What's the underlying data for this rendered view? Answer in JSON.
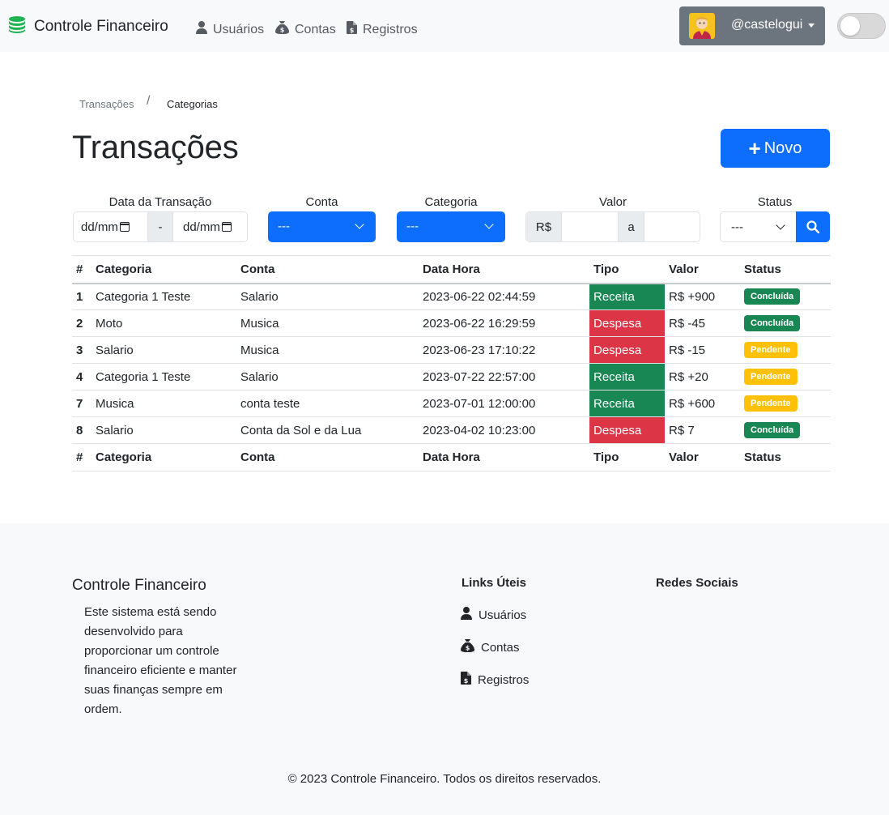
{
  "navbar": {
    "brand": "Controle Financeiro",
    "links": [
      {
        "label": "Usuários",
        "icon": "user-icon"
      },
      {
        "label": "Contas",
        "icon": "money-bag-icon"
      },
      {
        "label": "Registros",
        "icon": "invoice-icon"
      }
    ],
    "user": "@castelogui",
    "theme_toggle": "off"
  },
  "breadcrumb": [
    "Transações",
    "Categorias"
  ],
  "page": {
    "title": "Transações",
    "new_button": "Novo"
  },
  "filters": {
    "date_label": "Data da Transação",
    "date_from_placeholder": "dd/mm",
    "date_separator": "-",
    "date_to_placeholder": "dd/mm",
    "conta_label": "Conta",
    "conta_value": "---",
    "categoria_label": "Categoria",
    "categoria_value": "---",
    "valor_label": "Valor",
    "valor_prefix": "R$",
    "valor_separator": "a",
    "status_label": "Status",
    "status_value": "---"
  },
  "table": {
    "headers": [
      "#",
      "Categoria",
      "Conta",
      "Data Hora",
      "Tipo",
      "Valor",
      "Status"
    ],
    "rows": [
      {
        "id": "1",
        "categoria": "Categoria 1 Teste",
        "conta": "Salario",
        "data": "2023-06-22 02:44:59",
        "tipo": "Receita",
        "valor": "R$ +900",
        "status": "Concluída"
      },
      {
        "id": "2",
        "categoria": "Moto",
        "conta": "Musica",
        "data": "2023-06-22 16:29:59",
        "tipo": "Despesa",
        "valor": "R$ -45",
        "status": "Concluída"
      },
      {
        "id": "3",
        "categoria": "Salario",
        "conta": "Musica",
        "data": "2023-06-23 17:10:22",
        "tipo": "Despesa",
        "valor": "R$ -15",
        "status": "Pendente"
      },
      {
        "id": "4",
        "categoria": "Categoria 1 Teste",
        "conta": "Salario",
        "data": "2023-07-22 22:57:00",
        "tipo": "Receita",
        "valor": "R$ +20",
        "status": "Pendente"
      },
      {
        "id": "7",
        "categoria": "Musica",
        "conta": "conta teste",
        "data": "2023-07-01 12:00:00",
        "tipo": "Receita",
        "valor": "R$ +600",
        "status": "Pendente"
      },
      {
        "id": "8",
        "categoria": "Salario",
        "conta": "Conta da Sol e da Lua",
        "data": "2023-04-02 10:23:00",
        "tipo": "Despesa",
        "valor": "R$ 7",
        "status": "Concluída"
      }
    ]
  },
  "footer": {
    "title": "Controle Financeiro",
    "description": "Este sistema está sendo desenvolvido para proporcionar um controle financeiro eficiente e manter suas finanças sempre em ordem.",
    "links_title": "Links Úteis",
    "links": [
      "Usuários",
      "Contas",
      "Registros"
    ],
    "social_title": "Redes Sociais",
    "copyright": "© 2023 Controle Financeiro. Todos os direitos reservados."
  },
  "colors": {
    "primary": "#0d6efd",
    "success": "#198754",
    "danger": "#dc3545",
    "warning": "#ffc107",
    "secondary": "#6c757d"
  }
}
